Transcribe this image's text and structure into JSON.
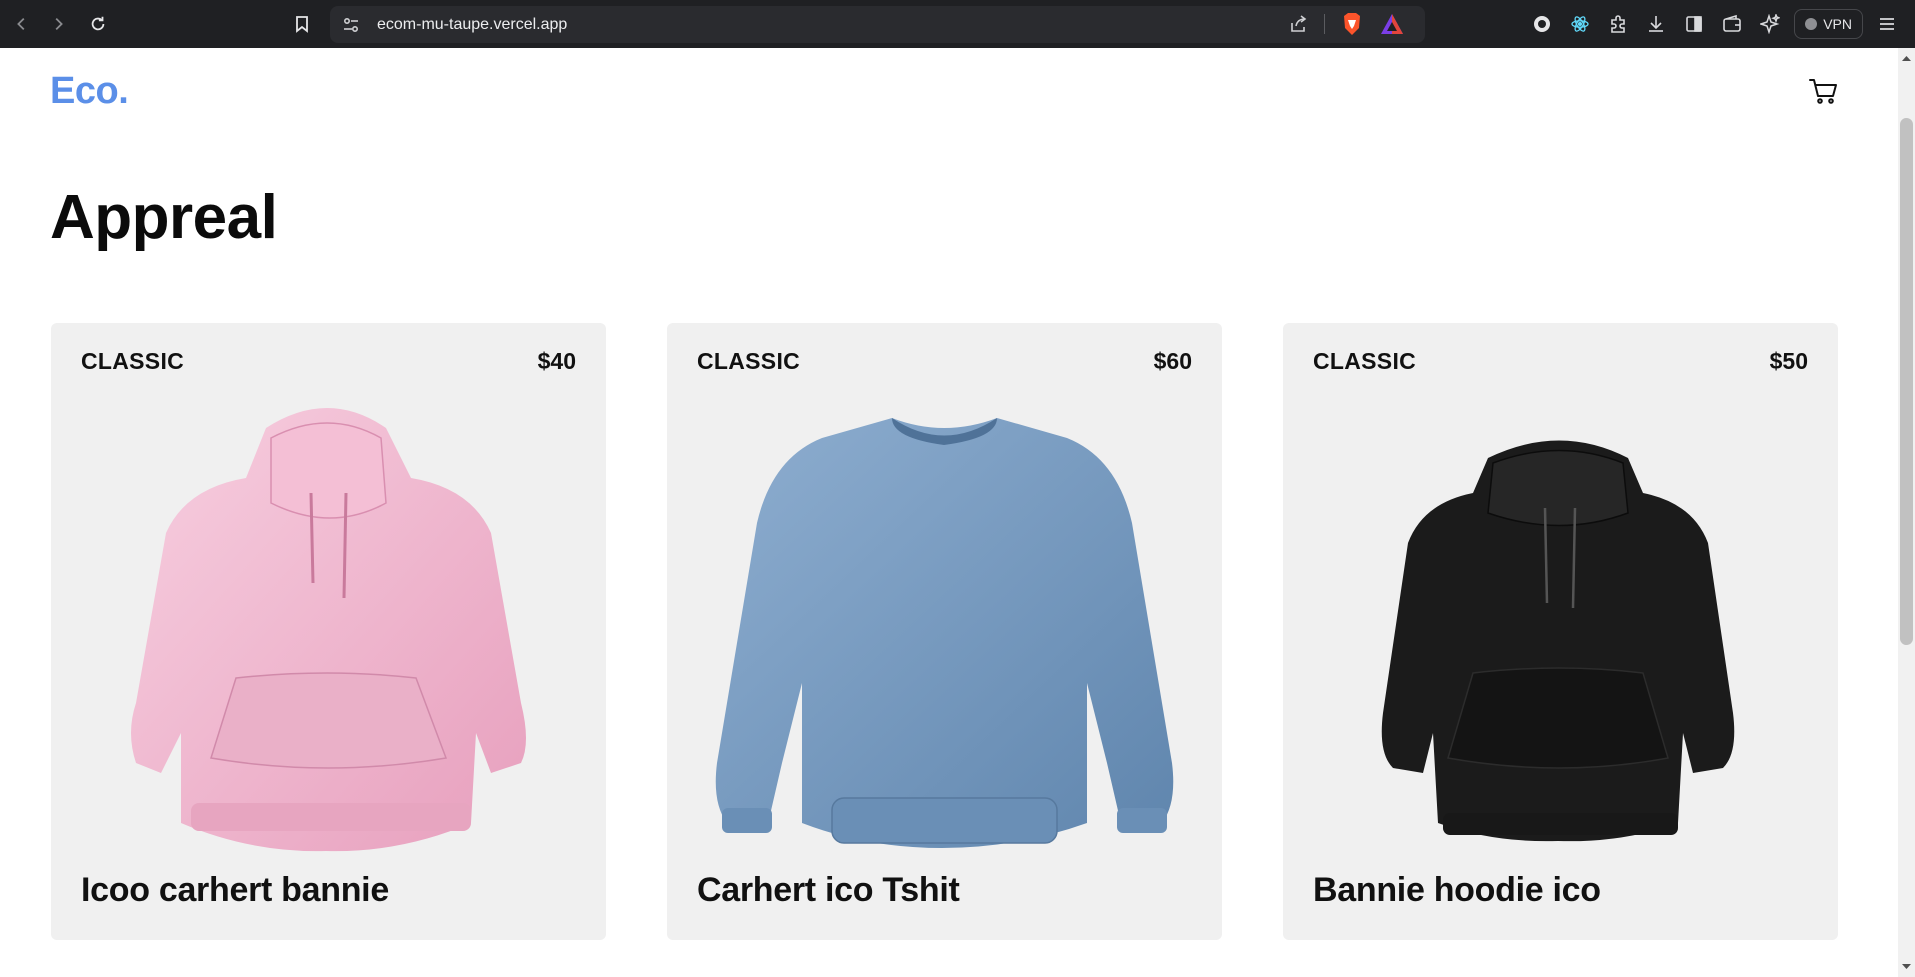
{
  "browser": {
    "url": "ecom-mu-taupe.vercel.app",
    "vpn_label": "VPN",
    "icons": [
      "back-icon",
      "forward-icon",
      "reload-icon",
      "bookmark-icon",
      "site-settings-icon",
      "share-icon",
      "brave-shields-icon",
      "brave-rewards-icon",
      "profile-icon",
      "react-devtools-icon",
      "extensions-icon",
      "downloads-icon",
      "sidebar-icon",
      "wallet-icon",
      "leo-ai-icon",
      "menu-icon"
    ]
  },
  "header": {
    "logo": "Eco.",
    "cart_icon": "cart-icon"
  },
  "main": {
    "title": "Appreal",
    "products": [
      {
        "tag": "CLASSIC",
        "price": "$40",
        "name": "Icoo carhert bannie",
        "color": "#f0b8cf",
        "kind": "hoodie"
      },
      {
        "tag": "CLASSIC",
        "price": "$60",
        "name": "Carhert ico Tshit",
        "color": "#6f93b8",
        "kind": "sweatshirt"
      },
      {
        "tag": "CLASSIC",
        "price": "$50",
        "name": "Bannie hoodie ico",
        "color": "#1b1b1b",
        "kind": "hoodie"
      }
    ]
  },
  "colors": {
    "brand": "#5b8fe8",
    "card_bg": "#f0f0f0",
    "chrome_bg": "#1f2023"
  }
}
